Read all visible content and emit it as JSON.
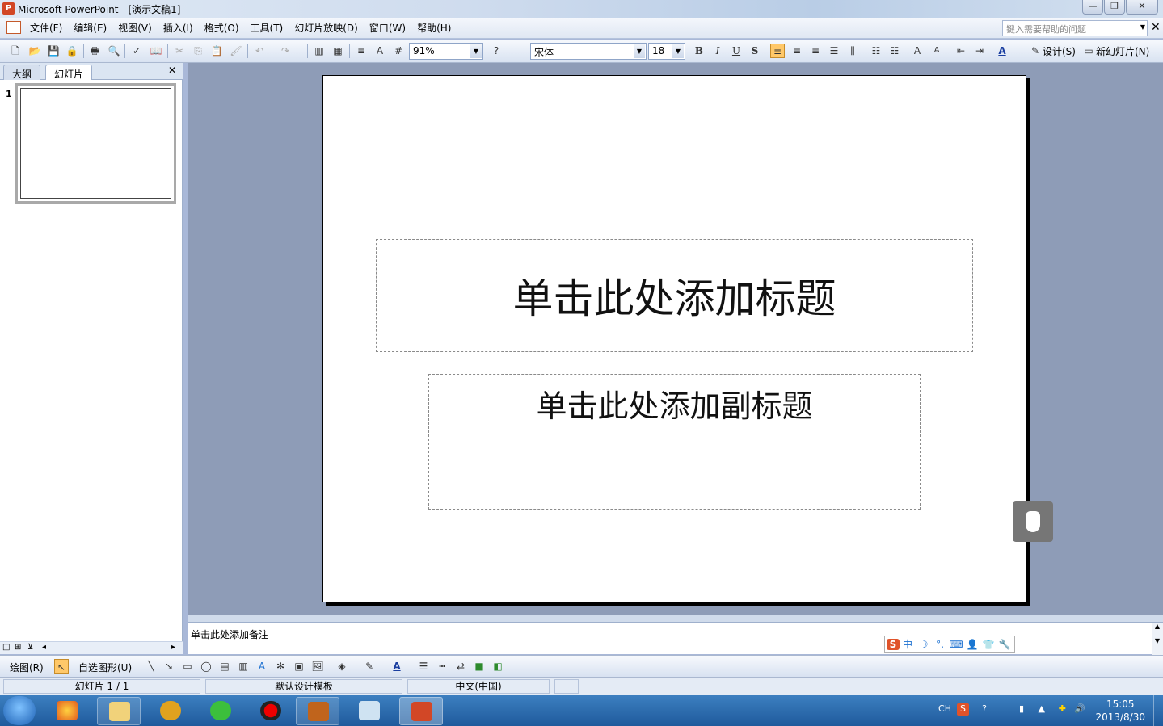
{
  "window": {
    "title": "Microsoft PowerPoint - [演示文稿1]",
    "minimize": "—",
    "restore": "❐",
    "close": "✕"
  },
  "menu": {
    "items": [
      "文件(F)",
      "编辑(E)",
      "视图(V)",
      "插入(I)",
      "格式(O)",
      "工具(T)",
      "幻灯片放映(D)",
      "窗口(W)",
      "帮助(H)"
    ],
    "help_placeholder": "键入需要帮助的问题",
    "close": "✕"
  },
  "toolbar": {
    "zoom": "91%",
    "font": "宋体",
    "font_size": "18",
    "bold": "B",
    "italic": "I",
    "underline": "U",
    "shadow": "S",
    "design": "设计(S)",
    "new_slide": "新幻灯片(N)"
  },
  "left_panel": {
    "tab_outline": "大纲",
    "tab_slides": "幻灯片",
    "close": "✕",
    "slide_number": "1"
  },
  "slide": {
    "title_placeholder": "单击此处添加标题",
    "subtitle_placeholder": "单击此处添加副标题"
  },
  "notes": {
    "placeholder": "单击此处添加备注"
  },
  "ime": {
    "items": [
      "S",
      "中",
      "☽",
      "°,",
      "⌨",
      "👤",
      "👕",
      "🔧"
    ]
  },
  "drawing_toolbar": {
    "draw": "绘图(R)",
    "autoshapes": "自选图形(U)"
  },
  "status": {
    "slide": "幻灯片 1 / 1",
    "template": "默认设计模板",
    "language": "中文(中国)"
  },
  "taskbar": {
    "tray_lang": "CH",
    "time": "15:05",
    "date": "2013/8/30"
  }
}
